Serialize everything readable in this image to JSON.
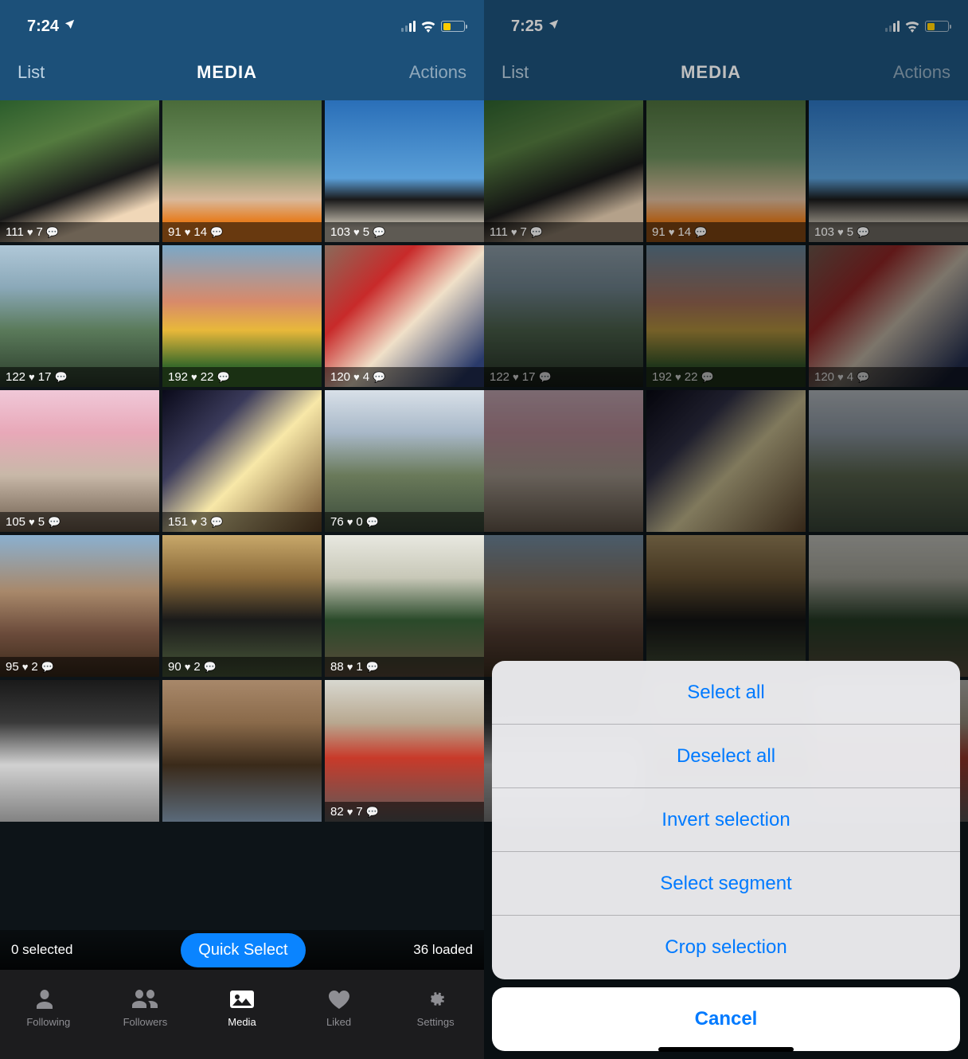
{
  "left": {
    "status": {
      "time": "7:24",
      "loc_icon": "location-arrow",
      "signal": 2,
      "battery_pct": 35
    },
    "nav": {
      "left": "List",
      "title": "MEDIA",
      "right": "Actions"
    },
    "tiles": [
      {
        "likes": 111,
        "comments": 7
      },
      {
        "likes": 91,
        "comments": 14
      },
      {
        "likes": 103,
        "comments": 5
      },
      {
        "likes": 122,
        "comments": 17
      },
      {
        "likes": 192,
        "comments": 22
      },
      {
        "likes": 120,
        "comments": 4
      },
      {
        "likes": 105,
        "comments": 5
      },
      {
        "likes": 151,
        "comments": 3
      },
      {
        "likes": 76,
        "comments": 0
      },
      {
        "likes": 95,
        "comments": 2
      },
      {
        "likes": 90,
        "comments": 2
      },
      {
        "likes": 88,
        "comments": 1
      },
      {
        "likes": null,
        "comments": null
      },
      {
        "likes": null,
        "comments": null
      },
      {
        "likes": 82,
        "comments": 7
      }
    ],
    "select_bar": {
      "selected_text": "0 selected",
      "quick_select": "Quick Select",
      "loaded_text": "36 loaded"
    },
    "tabs": [
      {
        "id": "following",
        "label": "Following"
      },
      {
        "id": "followers",
        "label": "Followers"
      },
      {
        "id": "media",
        "label": "Media",
        "active": true
      },
      {
        "id": "liked",
        "label": "Liked"
      },
      {
        "id": "settings",
        "label": "Settings"
      }
    ]
  },
  "right": {
    "status": {
      "time": "7:25",
      "loc_icon": "location-arrow",
      "signal": 2,
      "battery_pct": 35
    },
    "nav": {
      "left": "List",
      "title": "MEDIA",
      "right": "Actions"
    },
    "tiles": [
      {
        "likes": 111,
        "comments": 7
      },
      {
        "likes": 91,
        "comments": 14
      },
      {
        "likes": 103,
        "comments": 5
      },
      {
        "likes": 122,
        "comments": 17
      },
      {
        "likes": 192,
        "comments": 22
      },
      {
        "likes": 120,
        "comments": 4
      }
    ],
    "action_sheet": {
      "items": [
        "Select all",
        "Deselect all",
        "Invert selection",
        "Select segment",
        "Crop selection"
      ],
      "cancel": "Cancel"
    }
  }
}
